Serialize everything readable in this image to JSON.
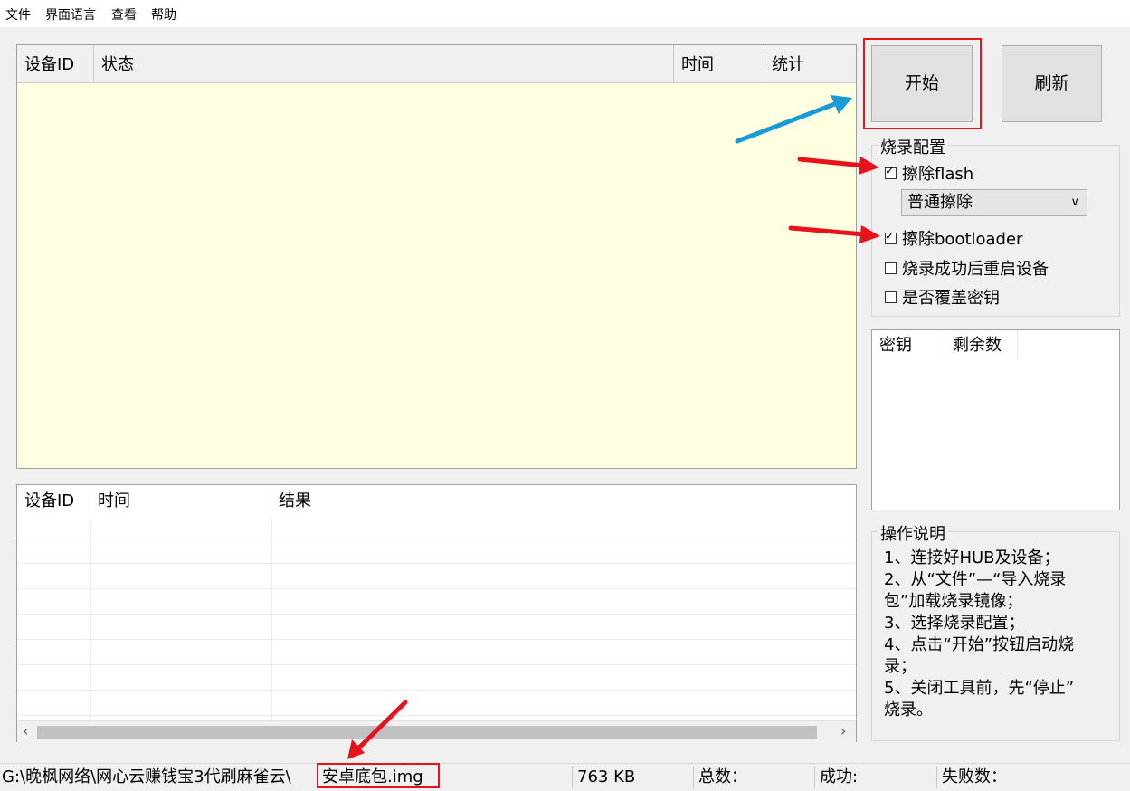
{
  "menu": [
    "文件",
    "界面语言",
    "查看",
    "帮助"
  ],
  "device_table": {
    "headers": [
      "设备ID",
      "状态",
      "时间",
      "统计"
    ]
  },
  "log_table": {
    "headers": [
      "设备ID",
      "时间",
      "结果"
    ]
  },
  "buttons": {
    "start": "开始",
    "refresh": "刷新"
  },
  "burn_config": {
    "title": "烧录配置",
    "erase_flash": {
      "label": "擦除flash",
      "checked": true
    },
    "erase_mode": "普通擦除",
    "erase_bootloader": {
      "label": "擦除bootloader",
      "checked": true
    },
    "reboot_after": {
      "label": "烧录成功后重启设备",
      "checked": false
    },
    "overwrite_key": {
      "label": "是否覆盖密钥",
      "checked": false
    }
  },
  "key_table": {
    "headers": [
      "密钥",
      "剩余数"
    ]
  },
  "instructions": {
    "title": "操作说明",
    "lines": [
      "1、连接好HUB及设备；",
      "2、从“文件”—“导入烧录",
      "包”加载烧录镜像；",
      "3、选择烧录配置；",
      "4、点击“开始”按钮启动烧",
      "录；",
      "5、关闭工具前，先“停止”",
      "烧录。"
    ]
  },
  "status_bar": {
    "path": "G:\\晚枫网络\\网心云赚钱宝3代刷麻雀云\\",
    "filename": "安卓底包.img",
    "size": "763 KB",
    "total_label": "总数：",
    "success_label": "成功:",
    "fail_label": "失败数："
  },
  "annotation_colors": {
    "highlight_box": "#e8131a",
    "red_arrow": "#e8131a",
    "blue_arrow": "#1a9ad6"
  }
}
